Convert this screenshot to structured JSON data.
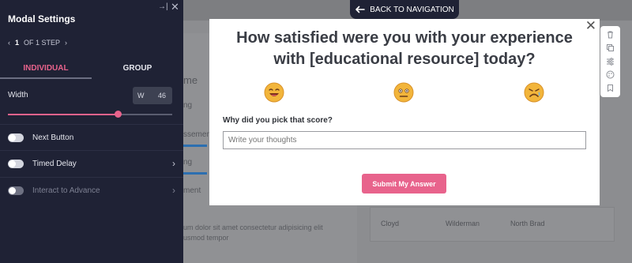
{
  "sidebar": {
    "title": "Modal Settings",
    "step": {
      "prev_icon": "chevron-left-icon",
      "current": "1",
      "rest": "OF 1 STEP",
      "next_icon": "chevron-right-icon"
    },
    "tabs": [
      {
        "label": "INDIVIDUAL",
        "active": true
      },
      {
        "label": "GROUP",
        "active": false
      }
    ],
    "width": {
      "label": "Width",
      "unit": "W",
      "value": "46",
      "slider_fraction": 0.67
    },
    "toggles": [
      {
        "label": "Next Button",
        "enabled": true,
        "chevron": false
      },
      {
        "label": "Timed Delay",
        "enabled": true,
        "chevron": true
      },
      {
        "label": "Interact to Advance",
        "enabled": false,
        "chevron": true
      }
    ],
    "accent_color": "#e8638c",
    "background_color": "#1f2235"
  },
  "nav": {
    "back_label": "BACK TO NAVIGATION"
  },
  "modal": {
    "question_line1": "How satisfied were you with your experience",
    "question_line2": "with [educational resource] today?",
    "faces": [
      "grinning-face-icon",
      "neutral-face-icon",
      "sad-face-icon"
    ],
    "why_label": "Why did you pick that score?",
    "input_placeholder": "Write your thoughts",
    "submit_label": "Submit My Answer"
  },
  "background_page": {
    "title_fragment": "me",
    "rows": [
      "ng",
      "ssement",
      "ng",
      "ment"
    ],
    "paragraph_line1": "um dolor sit amet consectetur adipisicing elit",
    "paragraph_line2": "usmod tempor",
    "table_cells": [
      "Cloyd",
      "Wilderman",
      "North Brad"
    ]
  },
  "toolbar_icons": [
    "trash-icon",
    "copy-icon",
    "sliders-icon",
    "palette-icon",
    "bookmark-icon"
  ]
}
